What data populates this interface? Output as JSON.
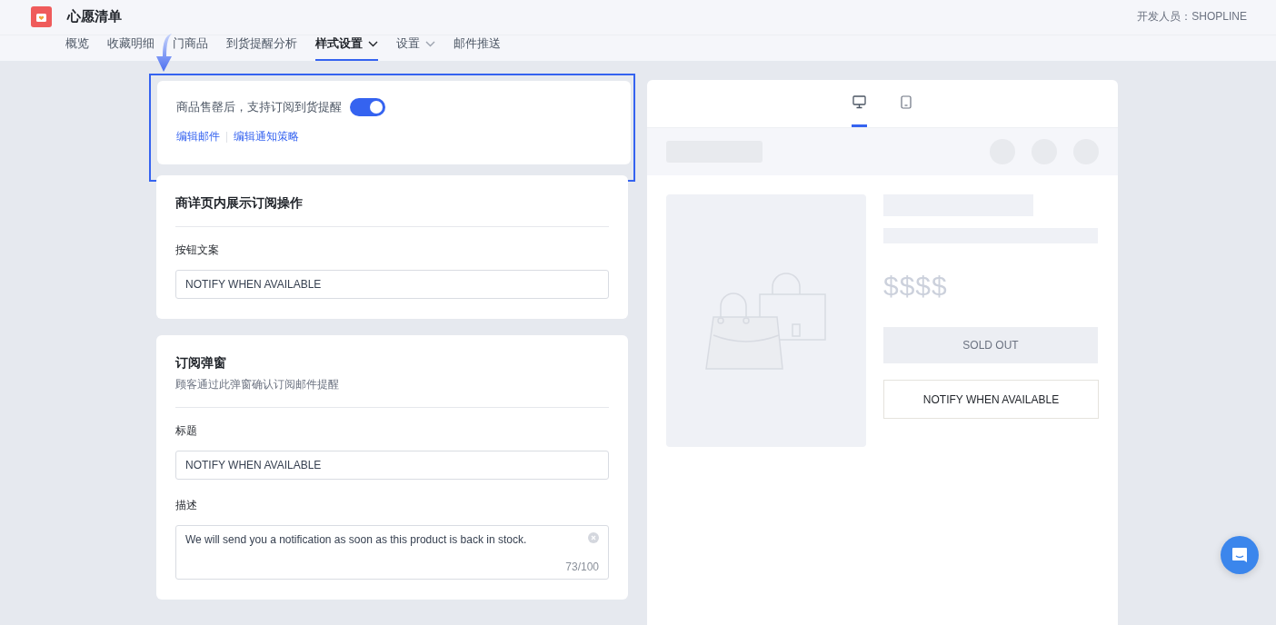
{
  "app": {
    "title": "心愿清单",
    "developer": "开发人员：SHOPLINE"
  },
  "tabs": [
    {
      "label": "概览",
      "selected": false,
      "dropdown": false
    },
    {
      "label": "收藏明细",
      "selected": false,
      "dropdown": false
    },
    {
      "label": "门商品",
      "selected": false,
      "dropdown": false
    },
    {
      "label": "到货提醒分析",
      "selected": false,
      "dropdown": false
    },
    {
      "label": "样式设置",
      "selected": true,
      "dropdown": true
    },
    {
      "label": "设置",
      "selected": false,
      "dropdown": true
    },
    {
      "label": "邮件推送",
      "selected": false,
      "dropdown": false
    }
  ],
  "restock": {
    "label": "商品售罄后，支持订阅到货提醒",
    "on": true,
    "links": [
      "编辑邮件",
      "编辑通知策略"
    ],
    "highlighted": true
  },
  "sections": [
    {
      "title": "商详页内展示订阅操作",
      "fields": [
        {
          "label": "按钮文案",
          "kind": "input",
          "value": "NOTIFY WHEN AVAILABLE"
        }
      ]
    },
    {
      "title": "订阅弹窗",
      "subtitle": "顾客通过此弹窗确认订阅邮件提醒",
      "fields": [
        {
          "label": "标题",
          "kind": "input",
          "value": "NOTIFY WHEN AVAILABLE"
        },
        {
          "label": "描述",
          "kind": "textarea",
          "value": "We will send you a notification as soon as this product is back in stock.",
          "count": "73/100"
        }
      ]
    }
  ],
  "preview": {
    "devices": [
      {
        "kind": "desktop",
        "selected": true
      },
      {
        "kind": "mobile",
        "selected": false
      }
    ],
    "price": "$$$$",
    "sold_out": "SOLD OUT",
    "notify": "NOTIFY WHEN AVAILABLE"
  }
}
